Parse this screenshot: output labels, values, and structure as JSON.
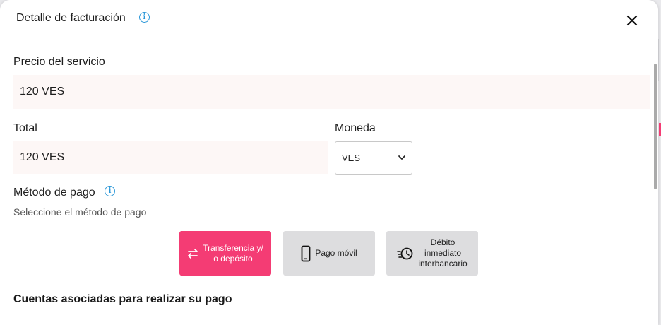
{
  "header": {
    "title": "Detalle de facturación"
  },
  "service_price": {
    "label": "Precio del servicio",
    "value": "120 VES"
  },
  "total": {
    "label": "Total",
    "value": "120 VES"
  },
  "currency": {
    "label": "Moneda",
    "selected": "VES"
  },
  "payment_method": {
    "label": "Método de pago",
    "hint": "Seleccione el método de pago",
    "options": [
      {
        "label": "Transferencia y/\no depósito",
        "icon": "transfer-arrows-icon",
        "selected": true
      },
      {
        "label": "Pago móvil",
        "icon": "smartphone-icon",
        "selected": false
      },
      {
        "label": "Débito\ninmediato\ninterbancario",
        "icon": "fast-clock-icon",
        "selected": false
      }
    ]
  },
  "accounts_section": {
    "title": "Cuentas asociadas para realizar su pago"
  },
  "colors": {
    "accent": "#f43c74",
    "info": "#2a97d8",
    "field_bg": "#fdf7f6"
  }
}
